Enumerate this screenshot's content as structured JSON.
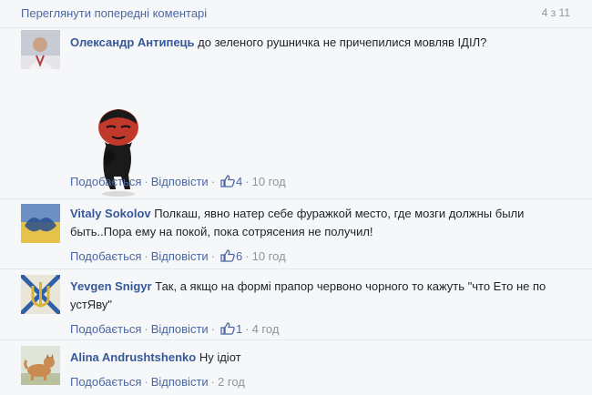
{
  "pager": {
    "link": "Переглянути попередні коментарі",
    "count": "4 з 11"
  },
  "action_labels": {
    "like": "Подобається",
    "reply": "Відповісти"
  },
  "comments": [
    {
      "author": "Олександр Антипець",
      "text": "до зеленого рушничка не причепилися мовляв ІДІЛ?",
      "likes": "4",
      "time": "10 год",
      "sticker": "cartoon-figure-sticker"
    },
    {
      "author": "Vitaly Sokolov",
      "text": "Полкаш, явно натер себе фуражкой место, где мозги должны были быть..Пора ему на покой, пока сотрясения не получил!",
      "likes": "6",
      "time": "10 год"
    },
    {
      "author": "Yevgen Snigyr",
      "text": "Так, а якщо на формі прапор червоно чорного то кажуть \"что Ето не по устЯву\"",
      "likes": "1",
      "time": "4 год"
    },
    {
      "author": "Alina Andrushtshenko",
      "text": "Ну ідіот",
      "time": "2 год"
    }
  ],
  "colors": {
    "link": "#4b67a1",
    "author": "#365899",
    "meta": "#90949c",
    "background": "#f6f7f9"
  }
}
